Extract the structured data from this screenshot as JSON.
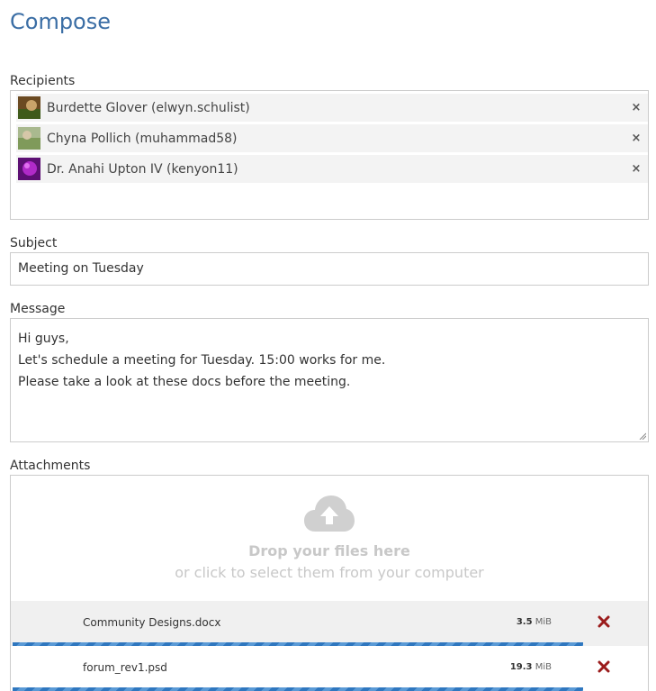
{
  "page": {
    "title": "Compose"
  },
  "recipients": {
    "label": "Recipients",
    "items": [
      {
        "name": "Burdette Glover (elwyn.schulist)",
        "remove": "×",
        "avatar_color": "#7a5a2e"
      },
      {
        "name": "Chyna Pollich (muhammad58)",
        "remove": "×",
        "avatar_color": "#9ab080"
      },
      {
        "name": "Dr. Anahi Upton IV (kenyon11)",
        "remove": "×",
        "avatar_color": "#8a1fa0"
      }
    ]
  },
  "subject": {
    "label": "Subject",
    "value": "Meeting on Tuesday"
  },
  "message": {
    "label": "Message",
    "lines": [
      "Hi guys,",
      "Let's schedule a meeting for Tuesday. 15:00 works for me.",
      "Please take a look at these docs before the meeting."
    ]
  },
  "attachments": {
    "label": "Attachments",
    "drop_title": "Drop your files here",
    "drop_subtitle": "or click to select them from your computer",
    "files": [
      {
        "name": "Community Designs.docx",
        "size": "3.5",
        "unit": "MiB",
        "progress": 1.0
      },
      {
        "name": "forum_rev1.psd",
        "size": "19.3",
        "unit": "MiB",
        "progress": 1.0
      }
    ]
  },
  "colors": {
    "accent": "#3b6ea5",
    "progress": "#2f77bf",
    "remove_file": "#9b1c1c"
  }
}
